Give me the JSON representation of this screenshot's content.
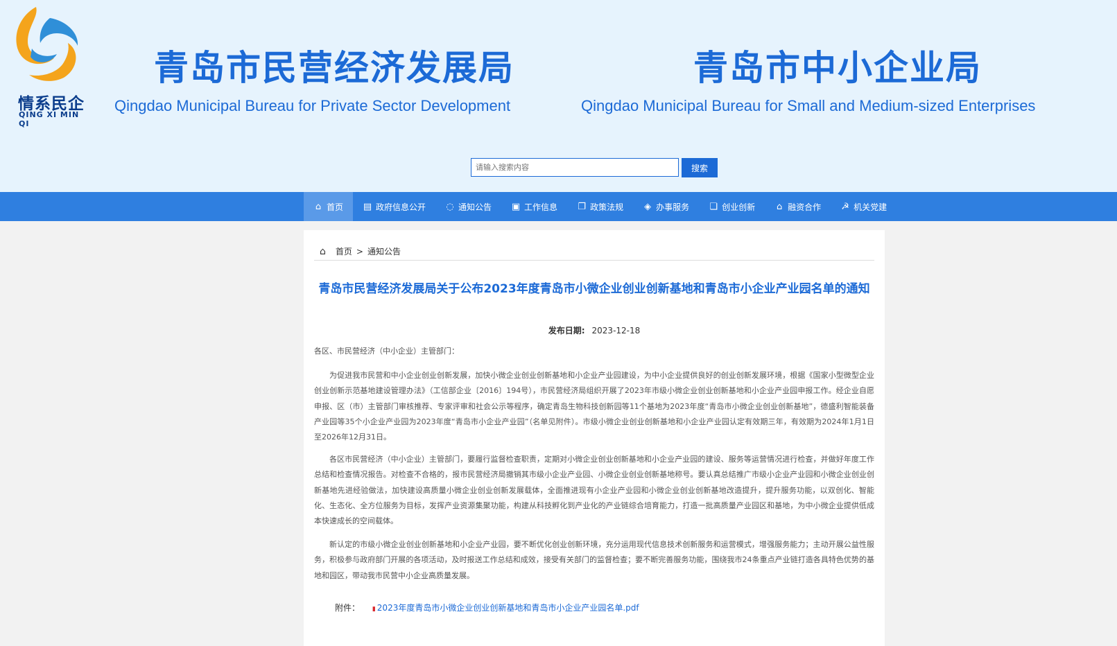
{
  "header": {
    "logo_cn": "情系民企",
    "logo_en": "QING XI MIN QI",
    "title1_cn": "青岛市民营经济发展局",
    "title1_en": "Qingdao Municipal Bureau for Private Sector Development",
    "title2_cn": "青岛市中小企业局",
    "title2_en": "Qingdao Municipal Bureau for Small and Medium-sized Enterprises"
  },
  "search": {
    "placeholder": "请输入搜索内容",
    "button_label": "搜索"
  },
  "nav": {
    "items": [
      {
        "label": "首页",
        "icon": "home-icon"
      },
      {
        "label": "政府信息公开",
        "icon": "document-icon"
      },
      {
        "label": "通知公告",
        "icon": "chat-icon"
      },
      {
        "label": "工作信息",
        "icon": "card-icon"
      },
      {
        "label": "政策法规",
        "icon": "file-icon"
      },
      {
        "label": "办事服务",
        "icon": "layers-icon"
      },
      {
        "label": "创业创新",
        "icon": "copy-icon"
      },
      {
        "label": "融资合作",
        "icon": "building-icon"
      },
      {
        "label": "机关党建",
        "icon": "party-icon"
      }
    ]
  },
  "breadcrumb": {
    "home": "首页",
    "separator": ">",
    "current": "通知公告"
  },
  "article": {
    "title": "青岛市民营经济发展局关于公布2023年度青岛市小微企业创业创新基地和青岛市小企业产业园名单的通知",
    "date_label": "发布日期:",
    "date": "2023-12-18",
    "salutation": "各区、市民营经济（中小企业）主管部门：",
    "paragraphs": [
      "为促进我市民营和中小企业创业创新发展，加快小微企业创业创新基地和小企业产业园建设，为中小企业提供良好的创业创新发展环境，根据《国家小型微型企业创业创新示范基地建设管理办法》（工信部企业〔2016〕194号），市民营经济局组织开展了2023年市级小微企业创业创新基地和小企业产业园申报工作。经企业自愿申报、区（市）主管部门审核推荐、专家评审和社会公示等程序，确定青岛生物科技创新园等11个基地为2023年度“青岛市小微企业创业创新基地”，德盛利智能装备产业园等35个小企业产业园为2023年度“青岛市小企业产业园”（名单见附件）。市级小微企业创业创新基地和小企业产业园认定有效期三年，有效期为2024年1月1日至2026年12月31日。",
      "各区市民营经济（中小企业）主管部门，要履行监督检查职责，定期对小微企业创业创新基地和小企业产业园的建设、服务等运营情况进行检查，并做好年度工作总结和检查情况报告。对检查不合格的，报市民营经济局撤销其市级小企业产业园、小微企业创业创新基地称号。要认真总结推广市级小企业产业园和小微企业创业创新基地先进经验做法，加快建设高质量小微企业创业创新发展载体，全面推进现有小企业产业园和小微企业创业创新基地改造提升，提升服务功能，以双创化、智能化、生态化、全方位服务为目标，发挥产业资源集聚功能，构建从科技孵化到产业化的产业链综合培育能力，打造一批高质量产业园区和基地，为中小微企业提供低成本快速成长的空间载体。",
      "新认定的市级小微企业创业创新基地和小企业产业园，要不断优化创业创新环境，充分运用现代信息技术创新服务和运营模式，增强服务能力；主动开展公益性服务，积极参与政府部门开展的各项活动，及时报送工作总结和成效，接受有关部门的监督检查；要不断完善服务功能，围绕我市24条重点产业链打造各具特色优势的基地和园区，带动我市民营中小企业高质量发展。"
    ],
    "attachment_label": "附件：",
    "attachment_name": "2023年度青岛市小微企业创业创新基地和青岛市小企业产业园名单.pdf"
  },
  "colors": {
    "primary": "#1c6ad6",
    "nav_bg": "#2f7fe0",
    "header_bg": "#e6f3fd"
  }
}
